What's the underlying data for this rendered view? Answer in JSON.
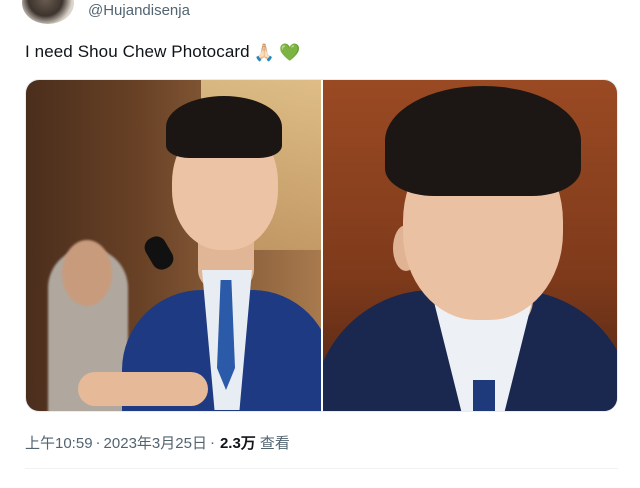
{
  "author": {
    "handle": "@Hujandisenja"
  },
  "tweet": {
    "text": "I need Shou Chew Photocard",
    "emojis": [
      "🙏🏻",
      "💚"
    ]
  },
  "media": {
    "count": 2
  },
  "meta": {
    "time": "上午10:59",
    "separator": "·",
    "date": "2023年3月25日",
    "views_count": "2.3万",
    "views_label": "查看"
  },
  "colors": {
    "text_primary": "#0f1419",
    "text_secondary": "#536471",
    "heart": "#4caf50"
  }
}
